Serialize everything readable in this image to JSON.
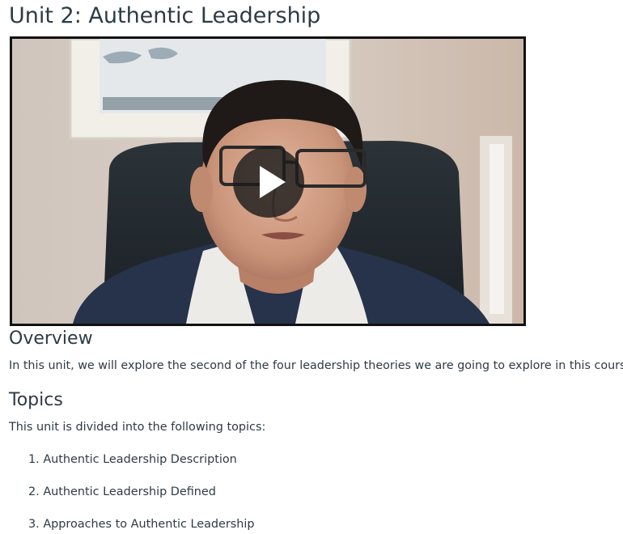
{
  "page": {
    "title": "Unit 2: Authentic Leadership"
  },
  "video": {
    "play_icon": "play-icon"
  },
  "overview": {
    "heading": "Overview",
    "text": "In this unit, we will explore the second of the four leadership theories we are going to explore in this course."
  },
  "topics": {
    "heading": "Topics",
    "intro": "This unit is divided into the following topics:",
    "items": [
      {
        "number": "1.",
        "label": "Authentic Leadership Description"
      },
      {
        "number": "2.",
        "label": "Authentic Leadership Defined"
      },
      {
        "number": "3.",
        "label": "Approaches to Authentic Leadership"
      }
    ]
  },
  "colors": {
    "text": "#2d3b45",
    "play_button_bg": "#1c1c1c",
    "video_border": "#111111"
  }
}
